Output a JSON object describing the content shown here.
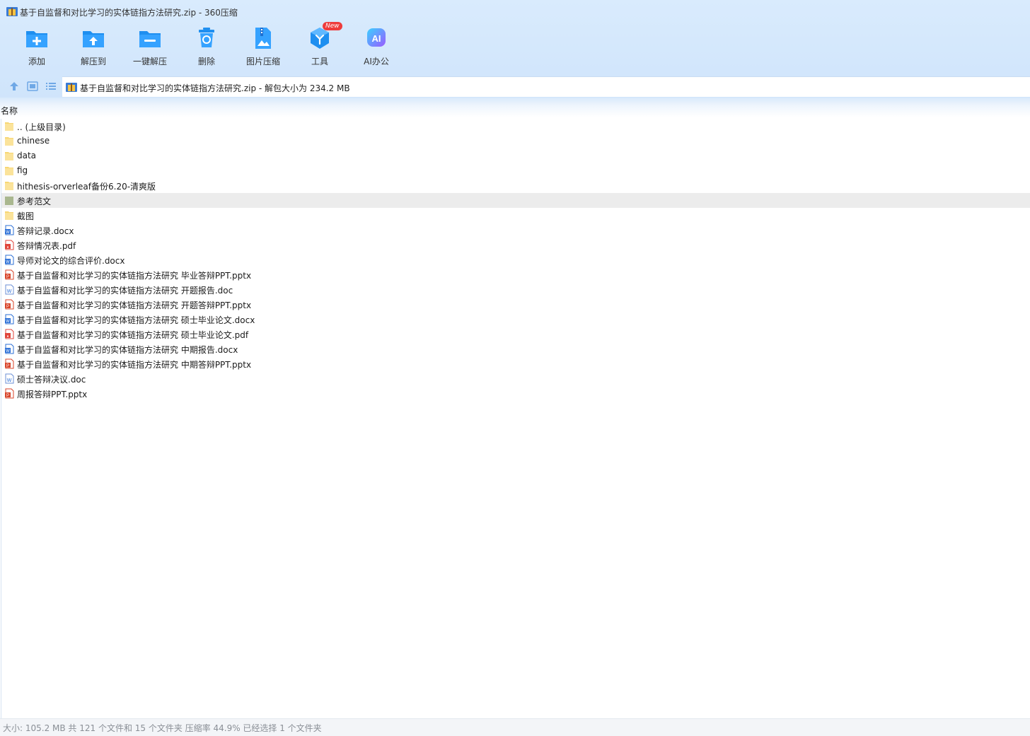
{
  "window": {
    "title": "基于自监督和对比学习的实体链指方法研究.zip - 360压缩"
  },
  "toolbar": {
    "items": [
      {
        "label": "添加",
        "icon": "add-icon"
      },
      {
        "label": "解压到",
        "icon": "extract-to-icon"
      },
      {
        "label": "一键解压",
        "icon": "one-click-extract-icon"
      },
      {
        "label": "删除",
        "icon": "delete-icon"
      },
      {
        "label": "图片压缩",
        "icon": "image-compress-icon"
      },
      {
        "label": "工具",
        "icon": "tools-icon",
        "badge": "New"
      },
      {
        "label": "AI办公",
        "icon": "ai-office-icon",
        "icon_text": "AI"
      }
    ]
  },
  "address": {
    "path": "基于自监督和对比学习的实体链指方法研究.zip - 解包大小为 234.2 MB"
  },
  "list": {
    "header": "名称",
    "files": [
      {
        "name": ".. (上级目录)",
        "type": "folder"
      },
      {
        "name": "chinese",
        "type": "folder"
      },
      {
        "name": "data",
        "type": "folder"
      },
      {
        "name": "fig",
        "type": "folder"
      },
      {
        "name": "hithesis-orverleaf备份6.20-清爽版",
        "type": "folder"
      },
      {
        "name": "参考范文",
        "type": "folder",
        "selected": true
      },
      {
        "name": "截图",
        "type": "folder"
      },
      {
        "name": "答辩记录.docx",
        "type": "docx"
      },
      {
        "name": "答辩情况表.pdf",
        "type": "pdf"
      },
      {
        "name": "导师对论文的综合评价.docx",
        "type": "docx"
      },
      {
        "name": "基于自监督和对比学习的实体链指方法研究 毕业答辩PPT.pptx",
        "type": "pptx"
      },
      {
        "name": "基于自监督和对比学习的实体链指方法研究 开题报告.doc",
        "type": "doc"
      },
      {
        "name": "基于自监督和对比学习的实体链指方法研究 开题答辩PPT.pptx",
        "type": "pptx"
      },
      {
        "name": "基于自监督和对比学习的实体链指方法研究 硕士毕业论文.docx",
        "type": "docx"
      },
      {
        "name": "基于自监督和对比学习的实体链指方法研究 硕士毕业论文.pdf",
        "type": "pdf"
      },
      {
        "name": "基于自监督和对比学习的实体链指方法研究 中期报告.docx",
        "type": "docx"
      },
      {
        "name": "基于自监督和对比学习的实体链指方法研究 中期答辩PPT.pptx",
        "type": "pptx"
      },
      {
        "name": "硕士答辩决议.doc",
        "type": "doc"
      },
      {
        "name": "周报答辩PPT.pptx",
        "type": "pptx"
      }
    ]
  },
  "status": {
    "text": "大小: 105.2 MB 共 121 个文件和 15 个文件夹 压缩率 44.9% 已经选择 1 个文件夹"
  },
  "colors": {
    "accent": "#1e8ff0",
    "folder": "#f7d774",
    "word": "#2b6fd6",
    "pdf": "#e0463c",
    "ppt": "#d8452b",
    "badge": "#ee3b3b"
  }
}
